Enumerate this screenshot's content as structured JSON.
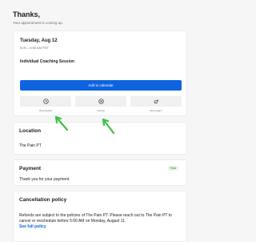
{
  "header": {
    "title": "Thanks,",
    "subtitle": "Your appointment is coming up."
  },
  "appointment": {
    "date": "Tuesday, Aug 12",
    "time": "5:00 – 5:50 AM PDT",
    "session": "Individual Coaching Session",
    "add_calendar": "Add to calendar",
    "actions": [
      {
        "label": "Reschedule",
        "icon": "clock-icon"
      },
      {
        "label": "Cancel",
        "icon": "cancel-icon"
      },
      {
        "label": "Book again",
        "icon": "redo-icon"
      }
    ]
  },
  "location": {
    "title": "Location",
    "value": "The Pain PT"
  },
  "payment": {
    "title": "Payment",
    "badge": "Paid",
    "text": "Thank you for your payment."
  },
  "cancellation": {
    "title": "Cancellation policy",
    "text": "Refunds are subject to the policies of The Pain PT. Please reach out to The Pain PT to cancel or reschedule before 5:00 AM on Monday, August 11.",
    "link": "See full policy"
  },
  "colors": {
    "accent": "#0e63e0",
    "annotation_arrow": "#3fbf48",
    "paid": "#1f8a3a"
  }
}
